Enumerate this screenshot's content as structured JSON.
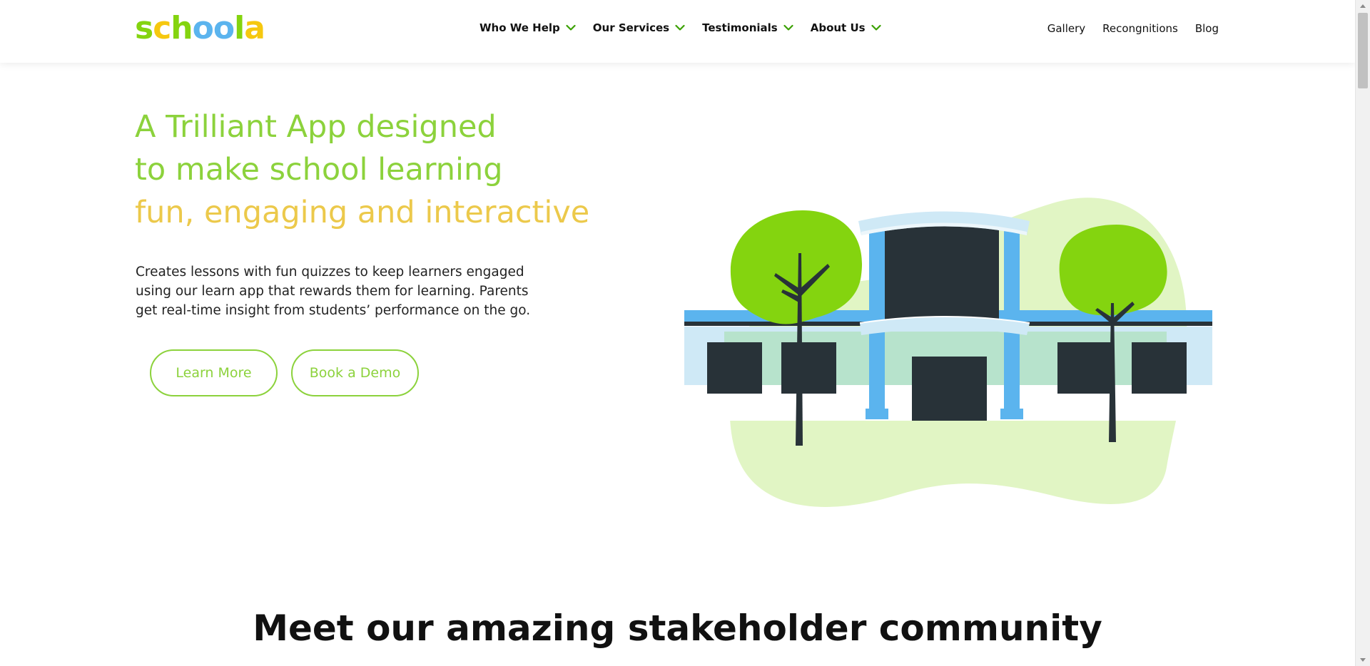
{
  "header": {
    "logo": {
      "letters": [
        "s",
        "c",
        "h",
        "o",
        "o",
        "l",
        "a"
      ],
      "letter_colors": [
        "#84d40f",
        "#f6c80f",
        "#84d40f",
        "#5bb4ee",
        "#5bb4ee",
        "#84d40f",
        "#f6c80f"
      ]
    },
    "nav_main": [
      {
        "label": "Who We Help",
        "icon": "chevron-down-icon"
      },
      {
        "label": "Our Services",
        "icon": "chevron-down-icon"
      },
      {
        "label": "Testimonials",
        "icon": "chevron-down-icon"
      },
      {
        "label": "About Us",
        "icon": "chevron-down-icon"
      }
    ],
    "nav_right": [
      {
        "label": "Gallery"
      },
      {
        "label": "Recongnitions"
      },
      {
        "label": "Blog"
      }
    ]
  },
  "hero": {
    "title_line1": "A Trilliant App designed",
    "title_line2": "to make school learning",
    "title_line3": "fun, engaging and interactive",
    "description": "Creates lessons with fun quizzes to keep learners engaged using our learn app that rewards them for learning. Parents get real-time insight from students’ performance on the go.",
    "buttons": {
      "learn_more": "Learn More",
      "book_demo": "Book a Demo"
    },
    "illustration": "school-building-illustration"
  },
  "section": {
    "title": "Meet our amazing stakeholder community"
  },
  "colors": {
    "brand_green": "#8cd23c",
    "brand_yellow": "#ecc94b",
    "brand_blue": "#5bb4ee",
    "dark": "#283238"
  }
}
